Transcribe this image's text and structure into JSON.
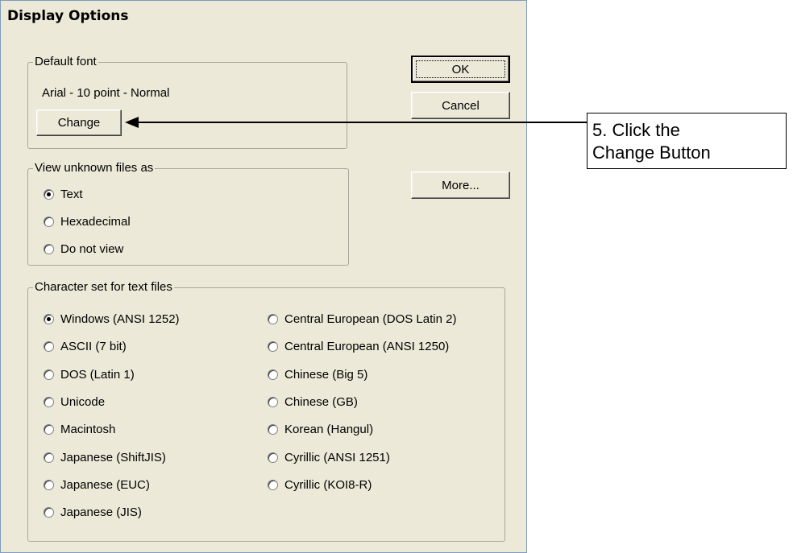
{
  "dialog": {
    "title": "Display Options",
    "buttons": {
      "ok": "OK",
      "cancel": "Cancel",
      "more": "More..."
    }
  },
  "default_font": {
    "legend": "Default font",
    "value": "Arial - 10 point - Normal",
    "change_label": "Change"
  },
  "view_unknown": {
    "legend": "View unknown files as",
    "options": [
      {
        "label": "Text",
        "checked": true
      },
      {
        "label": "Hexadecimal",
        "checked": false
      },
      {
        "label": "Do not view",
        "checked": false
      }
    ]
  },
  "charset": {
    "legend": "Character set for text files",
    "left": [
      {
        "label": "Windows (ANSI 1252)",
        "checked": true
      },
      {
        "label": "ASCII (7 bit)",
        "checked": false
      },
      {
        "label": "DOS (Latin 1)",
        "checked": false
      },
      {
        "label": "Unicode",
        "checked": false
      },
      {
        "label": "Macintosh",
        "checked": false
      },
      {
        "label": "Japanese (ShiftJIS)",
        "checked": false
      },
      {
        "label": "Japanese (EUC)",
        "checked": false
      },
      {
        "label": "Japanese (JIS)",
        "checked": false
      }
    ],
    "right": [
      {
        "label": "Central European (DOS Latin 2)",
        "checked": false
      },
      {
        "label": "Central European (ANSI 1250)",
        "checked": false
      },
      {
        "label": "Chinese (Big 5)",
        "checked": false
      },
      {
        "label": "Chinese (GB)",
        "checked": false
      },
      {
        "label": "Korean (Hangul)",
        "checked": false
      },
      {
        "label": "Cyrillic (ANSI 1251)",
        "checked": false
      },
      {
        "label": "Cyrillic (KOI8-R)",
        "checked": false
      }
    ]
  },
  "callout": {
    "line1": "5.   Click the",
    "line2": "Change Button"
  }
}
